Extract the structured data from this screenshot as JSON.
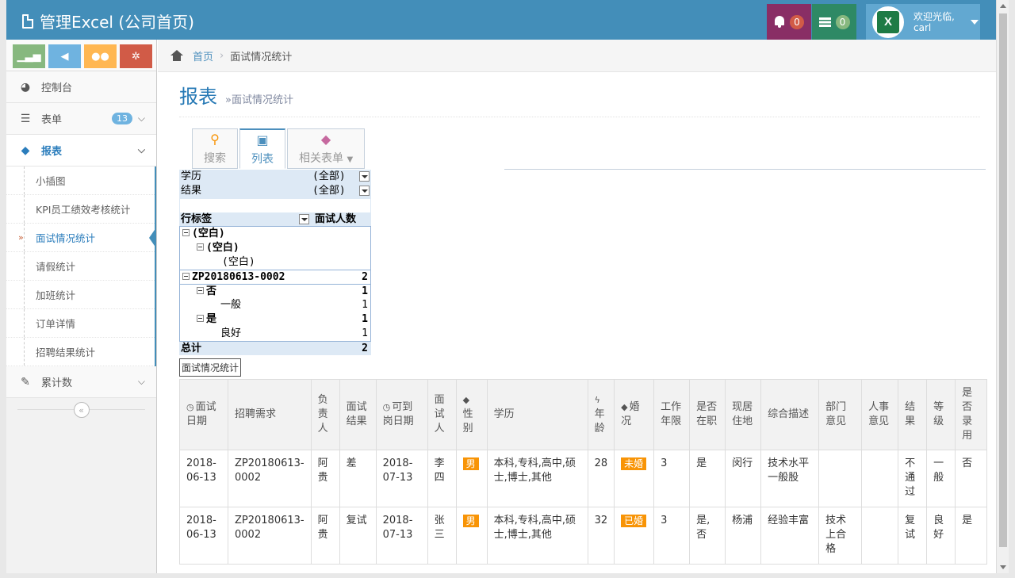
{
  "app": {
    "title": "管理Excel (公司首页)"
  },
  "navbar": {
    "notifications_count": "0",
    "tasks_count": "0",
    "avatar_text": "X",
    "welcome": "欢迎光临,",
    "username": "carl"
  },
  "sidebar": {
    "items": [
      {
        "label": "控制台"
      },
      {
        "label": "表单",
        "badge": "13"
      },
      {
        "label": "报表"
      },
      {
        "label": "累计数"
      }
    ],
    "sub_items": [
      "小插图",
      "KPI员工绩效考核统计",
      "面试情况统计",
      "请假统计",
      "加班统计",
      "订单详情",
      "招聘结果统计"
    ],
    "collapse_glyph": "«"
  },
  "breadcrumb": {
    "home": "首页",
    "current": "面试情况统计"
  },
  "page_header": {
    "title": "报表",
    "subtitle": "»面试情况统计"
  },
  "tabs": [
    {
      "label": "搜索",
      "icon": "search-icon"
    },
    {
      "label": "列表",
      "icon": "inbox-icon"
    },
    {
      "label": "相关表单",
      "icon": "tags-icon"
    }
  ],
  "pivot": {
    "filters": [
      {
        "name": "学历",
        "value": "(全部)"
      },
      {
        "name": "结果",
        "value": "(全部)"
      }
    ],
    "header": {
      "row_label": "行标签",
      "value_label": "面试人数"
    },
    "rows": [
      {
        "label": "(空白)",
        "value": ""
      },
      {
        "label": "(空白)",
        "value": ""
      },
      {
        "label": "(空白)",
        "value": ""
      },
      {
        "label": "ZP20180613-0002",
        "value": "2"
      },
      {
        "label": "否",
        "value": "1"
      },
      {
        "label": "一般",
        "value": "1"
      },
      {
        "label": "是",
        "value": "1"
      },
      {
        "label": "良好",
        "value": "1"
      }
    ],
    "total": {
      "label": "总计",
      "value": "2"
    },
    "caption": "面试情况统计"
  },
  "table": {
    "columns": [
      "面试日期",
      "招聘需求",
      "负责人",
      "面试结果",
      "可到岗日期",
      "面试人",
      "性别",
      "学历",
      "年龄",
      "婚况",
      "工作年限",
      "是否在职",
      "现居住地",
      "综合描述",
      "部门意见",
      "人事意见",
      "结果",
      "等级",
      "是否录用"
    ],
    "rows": [
      [
        "2018-06-13",
        "ZP20180613-0002",
        "阿贵",
        "差",
        "2018-07-13",
        "李四",
        "男",
        "本科,专科,高中,硕士,博士,其他",
        "28",
        "未婚",
        "3",
        "是",
        "闵行",
        "技术水平一般股",
        "",
        "",
        "不通过",
        "一般",
        "否"
      ],
      [
        "2018-06-13",
        "ZP20180613-0002",
        "阿贵",
        "复试",
        "2018-07-13",
        "张三",
        "男",
        "本科,专科,高中,硕士,博士,其他",
        "32",
        "已婚",
        "3",
        "是,否",
        "杨浦",
        "经验丰富",
        "技术上合格",
        "",
        "复试",
        "良好",
        "是"
      ]
    ]
  },
  "colors": {
    "navbar": "#438eb9",
    "accent": "#2679b5",
    "warning_label": "#f89406"
  }
}
